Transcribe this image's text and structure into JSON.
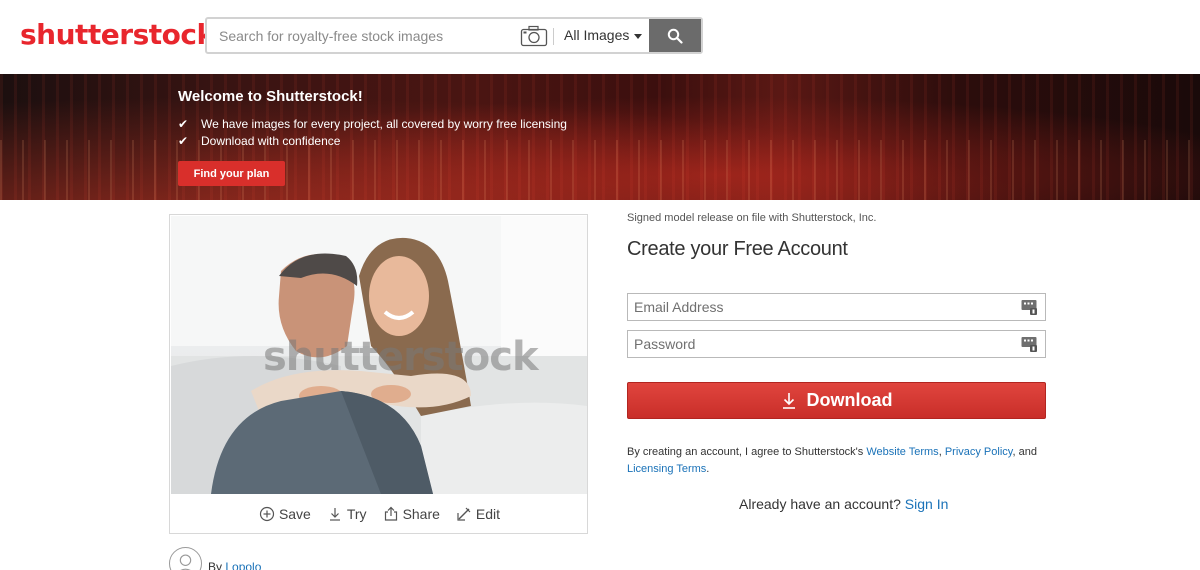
{
  "header": {
    "logo_text": "shutterstock",
    "search_placeholder": "Search for royalty-free stock images",
    "scope_label": "All Images"
  },
  "banner": {
    "title": "Welcome to Shutterstock!",
    "items": [
      "We have images for every project, all covered by worry free licensing",
      "Download with confidence"
    ],
    "cta_label": "Find your plan"
  },
  "image_card": {
    "watermark": "shutterstock",
    "actions": [
      {
        "label": "Save",
        "icon": "plus-circle-icon"
      },
      {
        "label": "Try",
        "icon": "download-icon"
      },
      {
        "label": "Share",
        "icon": "share-icon"
      },
      {
        "label": "Edit",
        "icon": "edit-icon"
      }
    ]
  },
  "author": {
    "prefix": "By",
    "name": "Lopolo"
  },
  "form": {
    "model_release": "Signed model release on file with Shutterstock, Inc.",
    "title": "Create your Free Account",
    "email_placeholder": "Email Address",
    "password_placeholder": "Password",
    "download_label": "Download",
    "terms_prefix": "By creating an account, I agree to Shutterstock's ",
    "terms_link1": "Website Terms",
    "terms_sep1": ", ",
    "terms_link2": "Privacy Policy",
    "terms_sep2": ", and ",
    "terms_link3": "Licensing Terms",
    "terms_end": ".",
    "signin_prefix": "Already have an account?",
    "signin_link": "Sign In"
  },
  "colors": {
    "brand_red": "#e8262d",
    "button_red": "#d92f2b",
    "link_blue": "#1a72b8",
    "search_button": "#6b6b6b"
  }
}
